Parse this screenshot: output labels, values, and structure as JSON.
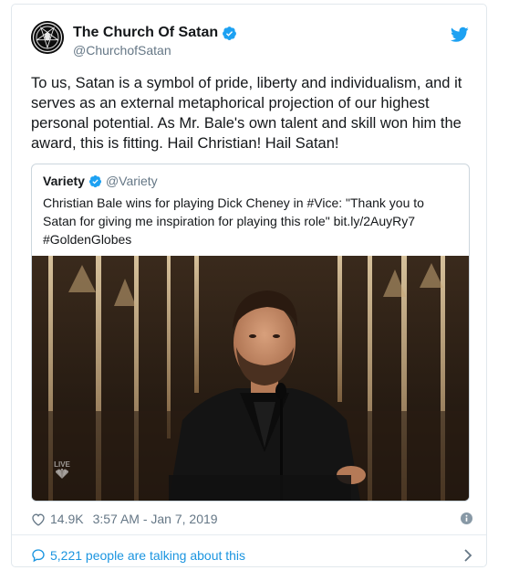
{
  "tweet": {
    "display_name": "The Church Of Satan",
    "handle": "@ChurchofSatan",
    "text": "To us, Satan is a symbol of pride, liberty and individualism, and it serves as an external metaphorical projection of our highest personal potential. As Mr. Bale's own talent and skill won him the award, this is fitting. Hail Christian! Hail Satan!",
    "likes": "14.9K",
    "timestamp": "3:57 AM - Jan 7, 2019",
    "talking": "5,221 people are talking about this"
  },
  "quote": {
    "display_name": "Variety",
    "handle": "@Variety",
    "text": "Christian Bale wins for playing Dick Cheney in #Vice: \"Thank you to Satan for giving me inspiration for playing this role\" bit.ly/2AuyRy7 #GoldenGlobes",
    "media_overlay": "LIVE"
  },
  "icons": {
    "avatar": "sigil-of-baphomet-avatar",
    "verified": "verified-badge-icon",
    "twitter": "twitter-bird-icon",
    "heart": "heart-icon",
    "info": "info-icon",
    "bubble": "speech-bubble-icon",
    "chevron": "chevron-right-icon"
  },
  "colors": {
    "accent": "#1da1f2",
    "text": "#14171a",
    "muted": "#657786",
    "border": "#e1e8ed"
  }
}
